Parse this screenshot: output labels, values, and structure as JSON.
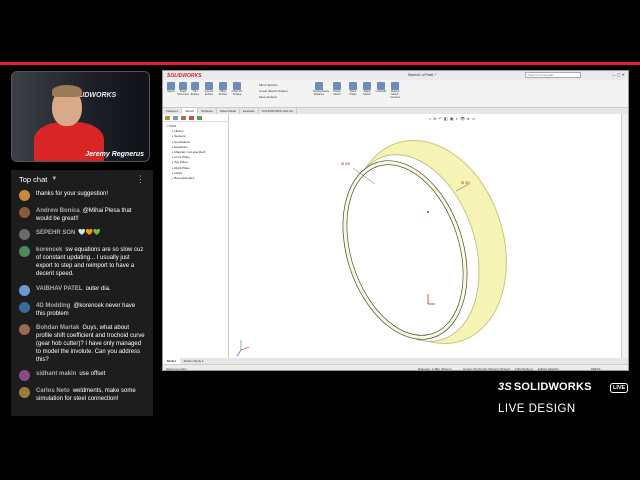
{
  "webcam": {
    "presenter_name": "Jeremy Regnerus",
    "logo_text": "SOLIDWORKS"
  },
  "chat": {
    "header": "Top chat",
    "messages": [
      {
        "author": "",
        "text": "thanks for your suggestion!",
        "avatar_color": "#c98a3c"
      },
      {
        "author": "Andrew Bonica",
        "text": "@Mihai Plesa that would be great!!",
        "avatar_color": "#8a5a3c"
      },
      {
        "author": "SEPEHR SON",
        "text": "🤍🧡💚",
        "avatar_color": "#6a6a6a"
      },
      {
        "author": "korencek",
        "text": "sw equations are so slow cuz of constant updating... I usually just export to step and reimport to have a decent speed.",
        "avatar_color": "#4a8a5a"
      },
      {
        "author": "VAIBHAV PATEL",
        "text": "outer dia.",
        "avatar_color": "#6a9ad0"
      },
      {
        "author": "4D Modding",
        "text": "@korencek never have this problem",
        "avatar_color": "#3a6a9a"
      },
      {
        "author": "Bohdan Martak",
        "text": "Guys, what about profile shift coefficient and trochoid curve (gear hob cutter)? I have only managed to model the involute. Can you address this?",
        "avatar_color": "#9a6a4a"
      },
      {
        "author": "sidhant makin",
        "text": "use offset",
        "avatar_color": "#8a4a8a"
      },
      {
        "author": "Carlos Neto",
        "text": "weldments, make some simulation for steel connection!",
        "avatar_color": "#a07a3a"
      }
    ]
  },
  "screen": {
    "app_logo": "SOLIDWORKS",
    "document_name": "Sketch1 of Part1 *",
    "search_placeholder": "Search Commands",
    "tabs": [
      "Features",
      "Sketch",
      "Surfaces",
      "Sheet Metal",
      "Evaluate",
      "SOLIDWORKS Add-Ins"
    ],
    "active_tab": "Sketch",
    "ribbon_buttons": [
      "Sketch",
      "Smart Dimension",
      "Trim Entities",
      "Convert Entities",
      "Offset Entities",
      "Offset On Surface",
      "Display/Delete Relations",
      "Repair Sketch",
      "Quick Snaps",
      "Rapid Sketch",
      "Instant2D",
      "Shaded Sketch Contours"
    ],
    "ribbon_small": [
      "Mirror Entities",
      "Linear Sketch Pattern",
      "Move Entities"
    ],
    "tree": [
      "Part1",
      "History",
      "Sensors",
      "Annotations",
      "Equations",
      "Material <not specified>",
      "Front Plane",
      "Top Plane",
      "Right Plane",
      "Origin",
      "Boss-Extrude1"
    ],
    "model_tabs": [
      "Model",
      "Motion Study 1"
    ],
    "status": {
      "left": "Select an entity",
      "diameter": "Diameter: 1.98in (Driven)",
      "center": "Center: 0in,0in,0in (Driven) (Driven)",
      "state": "Fully Defined",
      "editing": "Editing Sketch1",
      "units": "MMGS"
    },
    "dimensions": [
      "Ø 68",
      "Ø 50"
    ]
  },
  "branding": {
    "ds_logo": "SOLIDWORKS",
    "live_badge": "LIVE",
    "subtitle": "LIVE DESIGN"
  }
}
